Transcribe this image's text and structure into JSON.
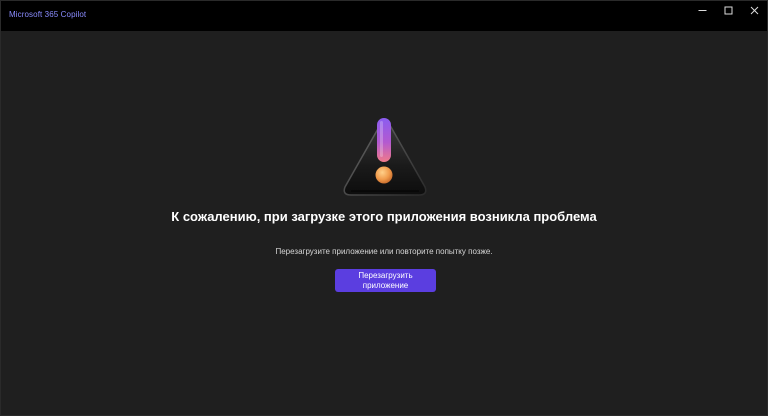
{
  "window": {
    "title": "Microsoft 365 Copilot",
    "controls": {
      "minimize": "minimize-icon",
      "maximize": "maximize-icon",
      "close": "close-icon"
    }
  },
  "error": {
    "icon": "warning-icon",
    "headline": "К сожалению, при загрузке этого приложения возникла проблема",
    "message": "Перезагрузите приложение или повторите попытку позже.",
    "reload_label": "Перезагрузить приложение"
  },
  "colors": {
    "background": "#1f1f1f",
    "titlebar": "#000000",
    "title_text": "#8a8cff",
    "button": "#5b3ee0",
    "exclamation_gradient_top": "#8a5cf0",
    "exclamation_gradient_bottom": "#f07a8a",
    "dot": "#f09a4a"
  }
}
